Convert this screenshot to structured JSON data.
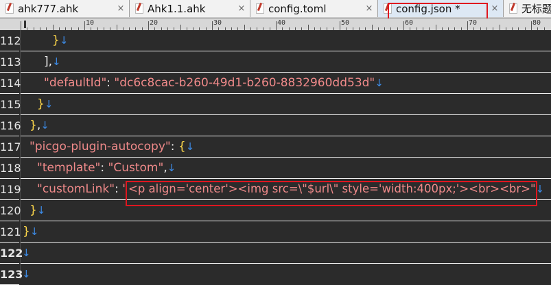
{
  "tabs": [
    {
      "label": "ahk777.ahk",
      "close": "×"
    },
    {
      "label": "Ahk1.1.ahk",
      "close": "×"
    },
    {
      "label": "config.toml",
      "close": "×"
    },
    {
      "label": "config.json *",
      "close": "×",
      "active": true
    },
    {
      "label": "无标题"
    }
  ],
  "ruler": [
    "10",
    "20",
    "30",
    "40",
    "50",
    "60",
    "70",
    "80"
  ],
  "line_numbers": [
    "112",
    "113",
    "114",
    "115",
    "116",
    "117",
    "118",
    "119",
    "120",
    "121",
    "122",
    "123"
  ],
  "code": {
    "l112": {
      "brace": "}"
    },
    "l113": {
      "text": "],"
    },
    "l114": {
      "key": "\"defaultId\"",
      "sep": ": ",
      "value": "\"dc6c8cac-b260-49d1-b260-8832960dd53d\""
    },
    "l115": {
      "brace": "}"
    },
    "l116": {
      "brace": "}",
      "comma": ","
    },
    "l117": {
      "key": "\"picgo-plugin-autocopy\"",
      "sep": ": ",
      "brace": "{"
    },
    "l118": {
      "key": "\"template\"",
      "sep": ": ",
      "value": "\"Custom\"",
      "comma": ","
    },
    "l119": {
      "key": "\"customLink\"",
      "sep": ": ",
      "quote": "\"",
      "value": "<p align='center'><img src=\\\"$url\\\" style='width:400px;'><br><br>\""
    },
    "l120": {
      "brace": "}"
    },
    "l121": {
      "brace": "}"
    }
  },
  "newline_glyph": "↓",
  "colors": {
    "highlight": "#e0161f",
    "newline": "#3d8be6",
    "string": "#f08a8a",
    "brace": "#ffd84a",
    "background": "#2b2b2b"
  }
}
